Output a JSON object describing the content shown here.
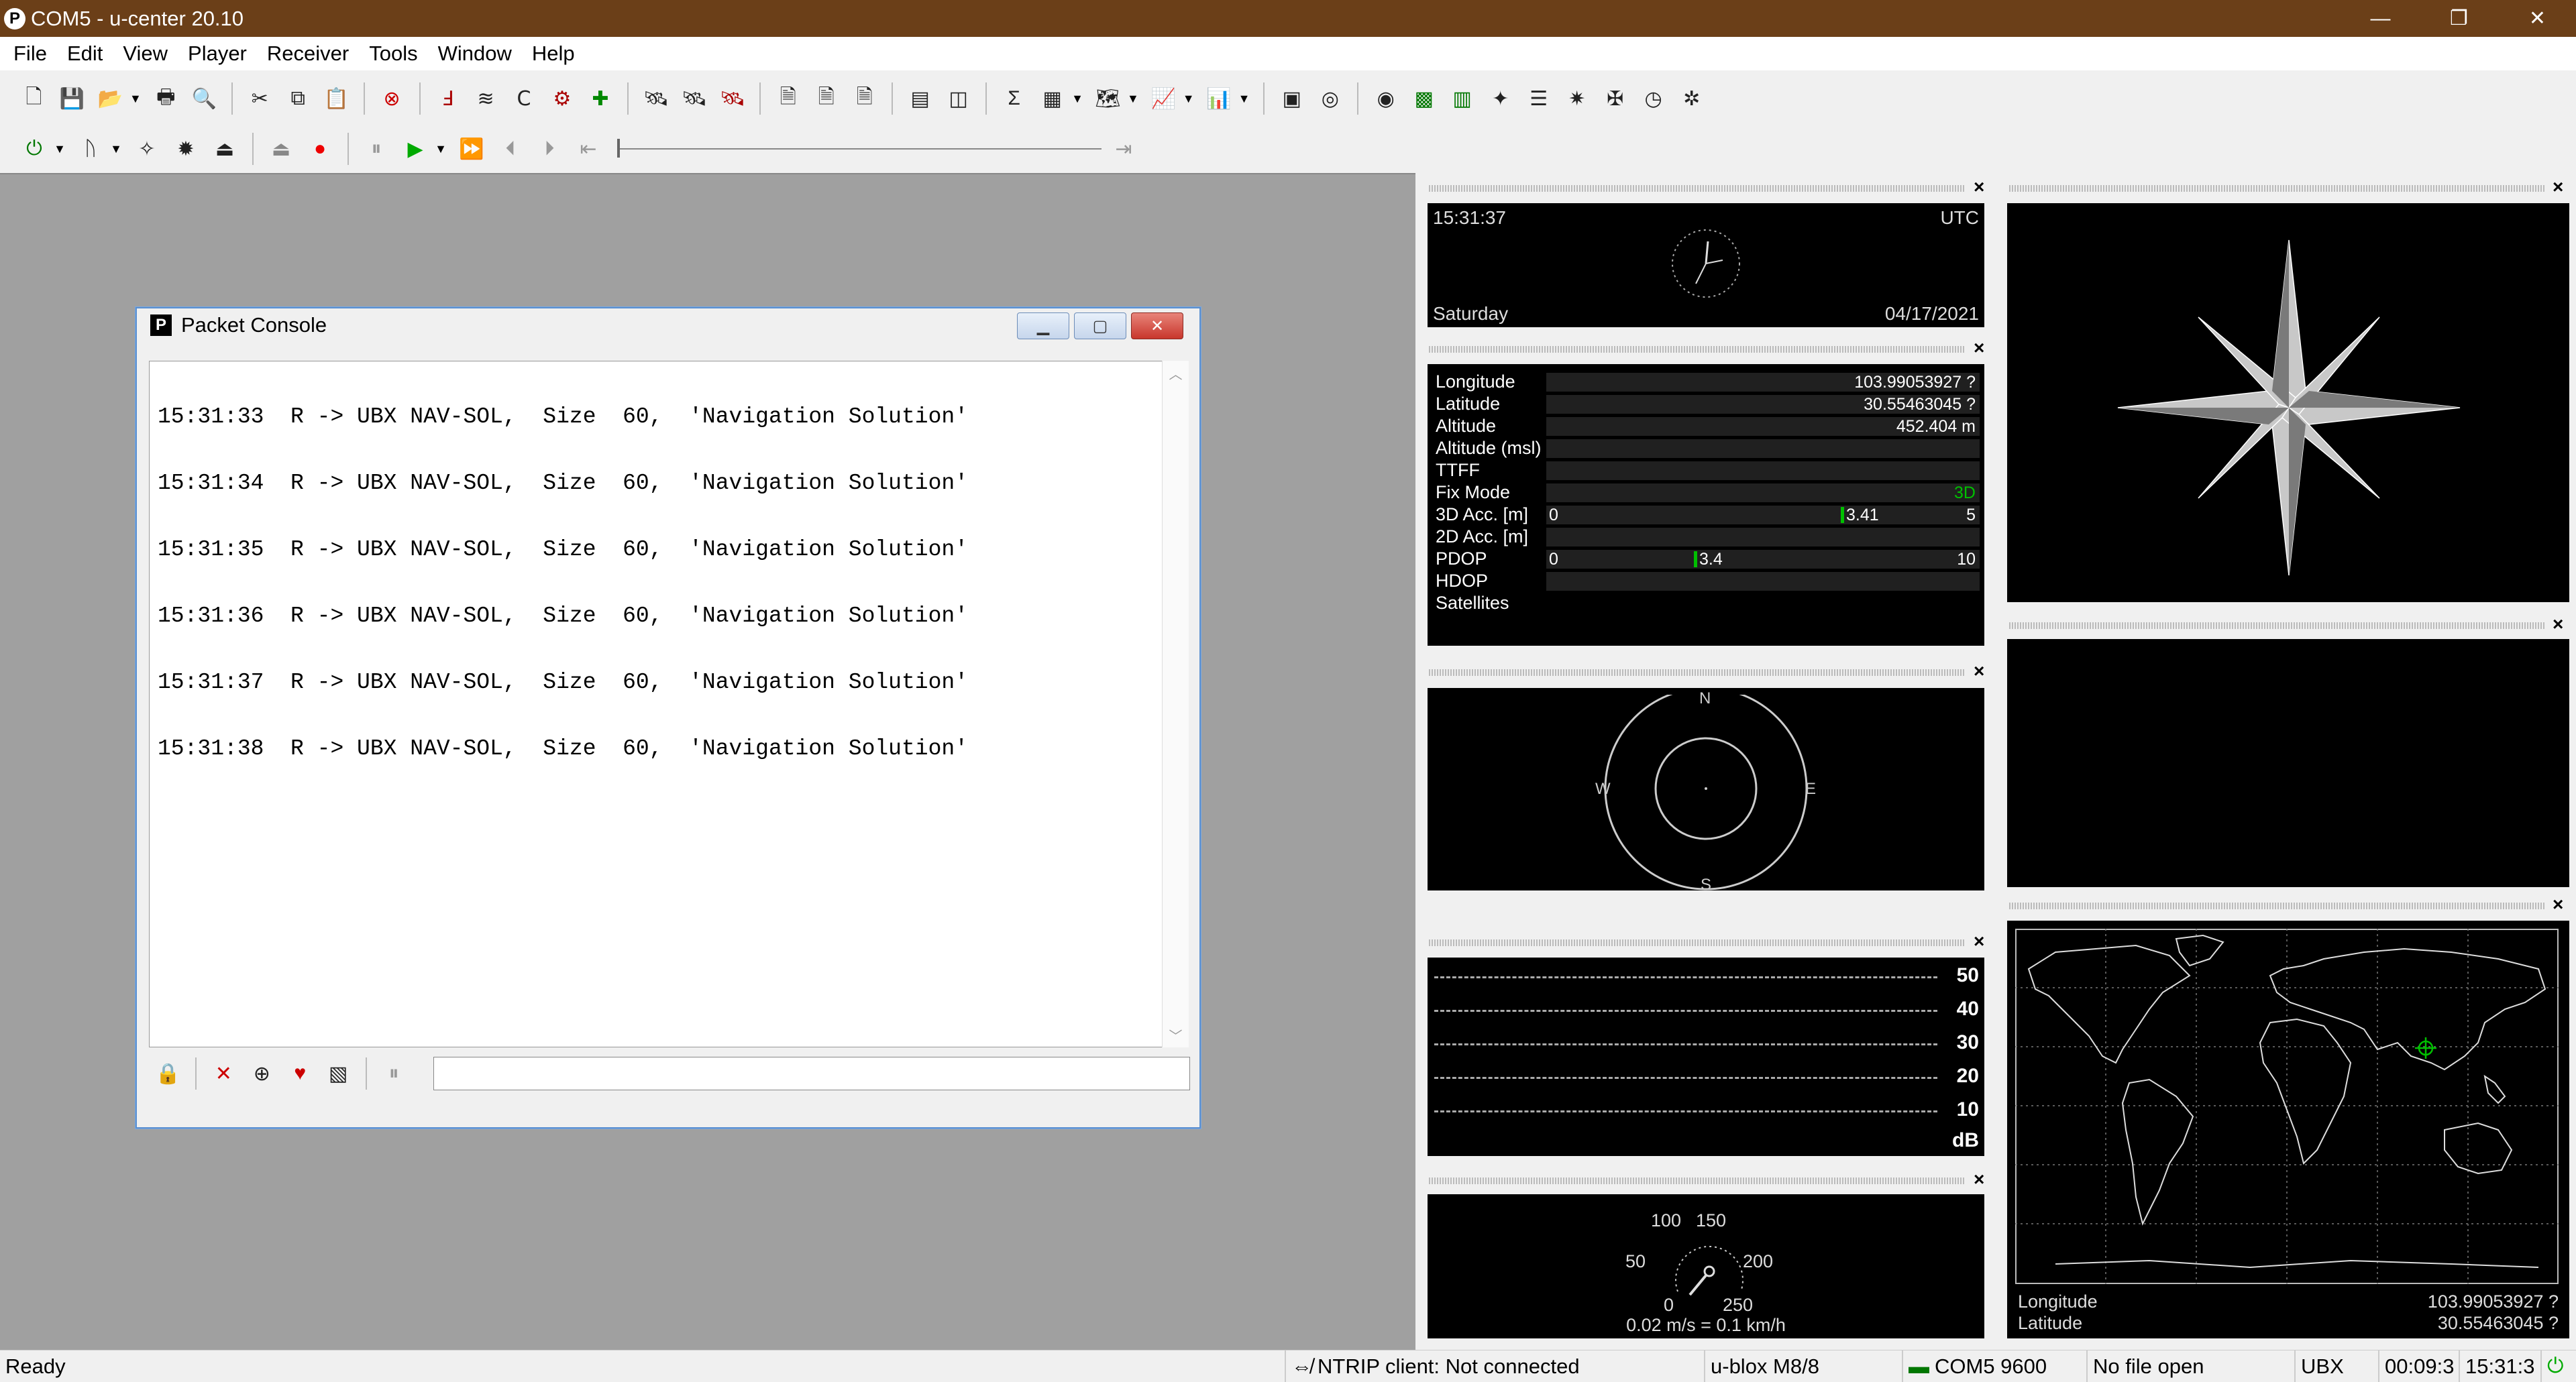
{
  "window": {
    "title": "COM5 - u-center 20.10",
    "app_icon": "P",
    "minimize": "—",
    "restore": "❐",
    "close": "✕"
  },
  "menu": [
    "File",
    "Edit",
    "View",
    "Player",
    "Receiver",
    "Tools",
    "Window",
    "Help"
  ],
  "console": {
    "title": "Packet Console",
    "lines": [
      "15:31:33  R -> UBX NAV-SOL,  Size  60,  'Navigation Solution'",
      "15:31:34  R -> UBX NAV-SOL,  Size  60,  'Navigation Solution'",
      "15:31:35  R -> UBX NAV-SOL,  Size  60,  'Navigation Solution'",
      "15:31:36  R -> UBX NAV-SOL,  Size  60,  'Navigation Solution'",
      "15:31:37  R -> UBX NAV-SOL,  Size  60,  'Navigation Solution'",
      "15:31:38  R -> UBX NAV-SOL,  Size  60,  'Navigation Solution'"
    ]
  },
  "clock": {
    "time": "15:31:37",
    "zone": "UTC",
    "day": "Saturday",
    "date": "04/17/2021"
  },
  "data_view": {
    "rows": [
      {
        "label": "Longitude",
        "value": "103.99053927 ?"
      },
      {
        "label": "Latitude",
        "value": "30.55463045 ?"
      },
      {
        "label": "Altitude",
        "value": "452.404 m"
      },
      {
        "label": "Altitude (msl)",
        "value": ""
      },
      {
        "label": "TTFF",
        "value": ""
      },
      {
        "label": "Fix Mode",
        "value": "3D"
      },
      {
        "label": "3D Acc. [m]",
        "value": "5",
        "min": "0",
        "mark": "3.41",
        "fraction": 0.68
      },
      {
        "label": "2D Acc. [m]",
        "value": ""
      },
      {
        "label": "PDOP",
        "value": "10",
        "min": "0",
        "mark": "3.4",
        "fraction": 0.34
      },
      {
        "label": "HDOP",
        "value": ""
      },
      {
        "label": "Satellites",
        "value": ""
      }
    ],
    "fix_color": "#00c000"
  },
  "sky": {
    "n": "N",
    "s": "S",
    "e": "E",
    "w": "W"
  },
  "signal": {
    "ticks": [
      "50",
      "40",
      "30",
      "20",
      "10"
    ],
    "unit": "dB"
  },
  "speed": {
    "ticks": {
      "a": "0",
      "b": "50",
      "c": "100",
      "d": "150",
      "e": "200",
      "f": "250"
    },
    "readout": "0.02 m/s = 0.1 km/h"
  },
  "map": {
    "lon_label": "Longitude",
    "lon_value": "103.99053927 ?",
    "lat_label": "Latitude",
    "lat_value": "30.55463045 ?"
  },
  "status": {
    "ready": "Ready",
    "ntrip": "NTRIP client: Not connected",
    "receiver": "u-blox M8/8",
    "port": "COM5 9600",
    "file": "No file open",
    "protocol": "UBX",
    "elapsed": "00:09:3",
    "time": "15:31:3"
  }
}
